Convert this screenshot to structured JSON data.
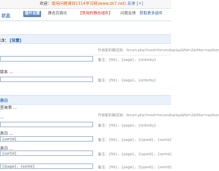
{
  "header": {
    "notice_pre": "欢迎：",
    "notice_main": "使用问题请到1314学习网",
    "notice_site": "(www.zb7.net)",
    "notice_post": "反馈",
    "notice_plus": "[+]"
  },
  "title": "状态",
  "tabs": [
    {
      "label": "插件设置"
    },
    {
      "label": "静态页面化"
    },
    {
      "label": "【常用的静态插件】"
    },
    {
      "label": "问题反馈"
    },
    {
      "label": "获取更多插件"
    }
  ],
  "rows": [
    {
      "label": ":3：",
      "link": "[设置]"
    },
    {
      "hint": "升级前的路径如：forum.php?mod=forumdisplay&fid=2&filter=author"
    },
    {
      "label": "",
      "input": "",
      "hint": "备注：{fid}，{page}，{orderby}"
    },
    {
      "label": "版本 ...",
      "hint": ""
    },
    {
      "label": "",
      "input": "",
      "hint": "备注：{fid}，{page}，{orderby}"
    },
    {
      "label": "表日",
      "hint": ""
    },
    {
      "label": "查询表 ..."
    },
    {
      "hint": "升级前的路径如：forum.php?mod=forumdisplay&fid=2&filter=author"
    },
    {
      "label": "...",
      "input": "",
      "hint": "备注：{fid}，{page}，{orderby}"
    },
    {
      "label": "表日 ...",
      "input": "{sortid}",
      "hint": "备注：{fid}，{page}，{typeid}，{sortid}"
    },
    {
      "label": "表日 ...",
      "input": "{sortid}",
      "hint": "备注：{fid}，{page}，{typeid}，{sortid}"
    },
    {
      "label": "",
      "input": "{/page}，{sortid}",
      "hint": "备注：{fid}，{page}，{typeid}，{sortid}"
    }
  ]
}
